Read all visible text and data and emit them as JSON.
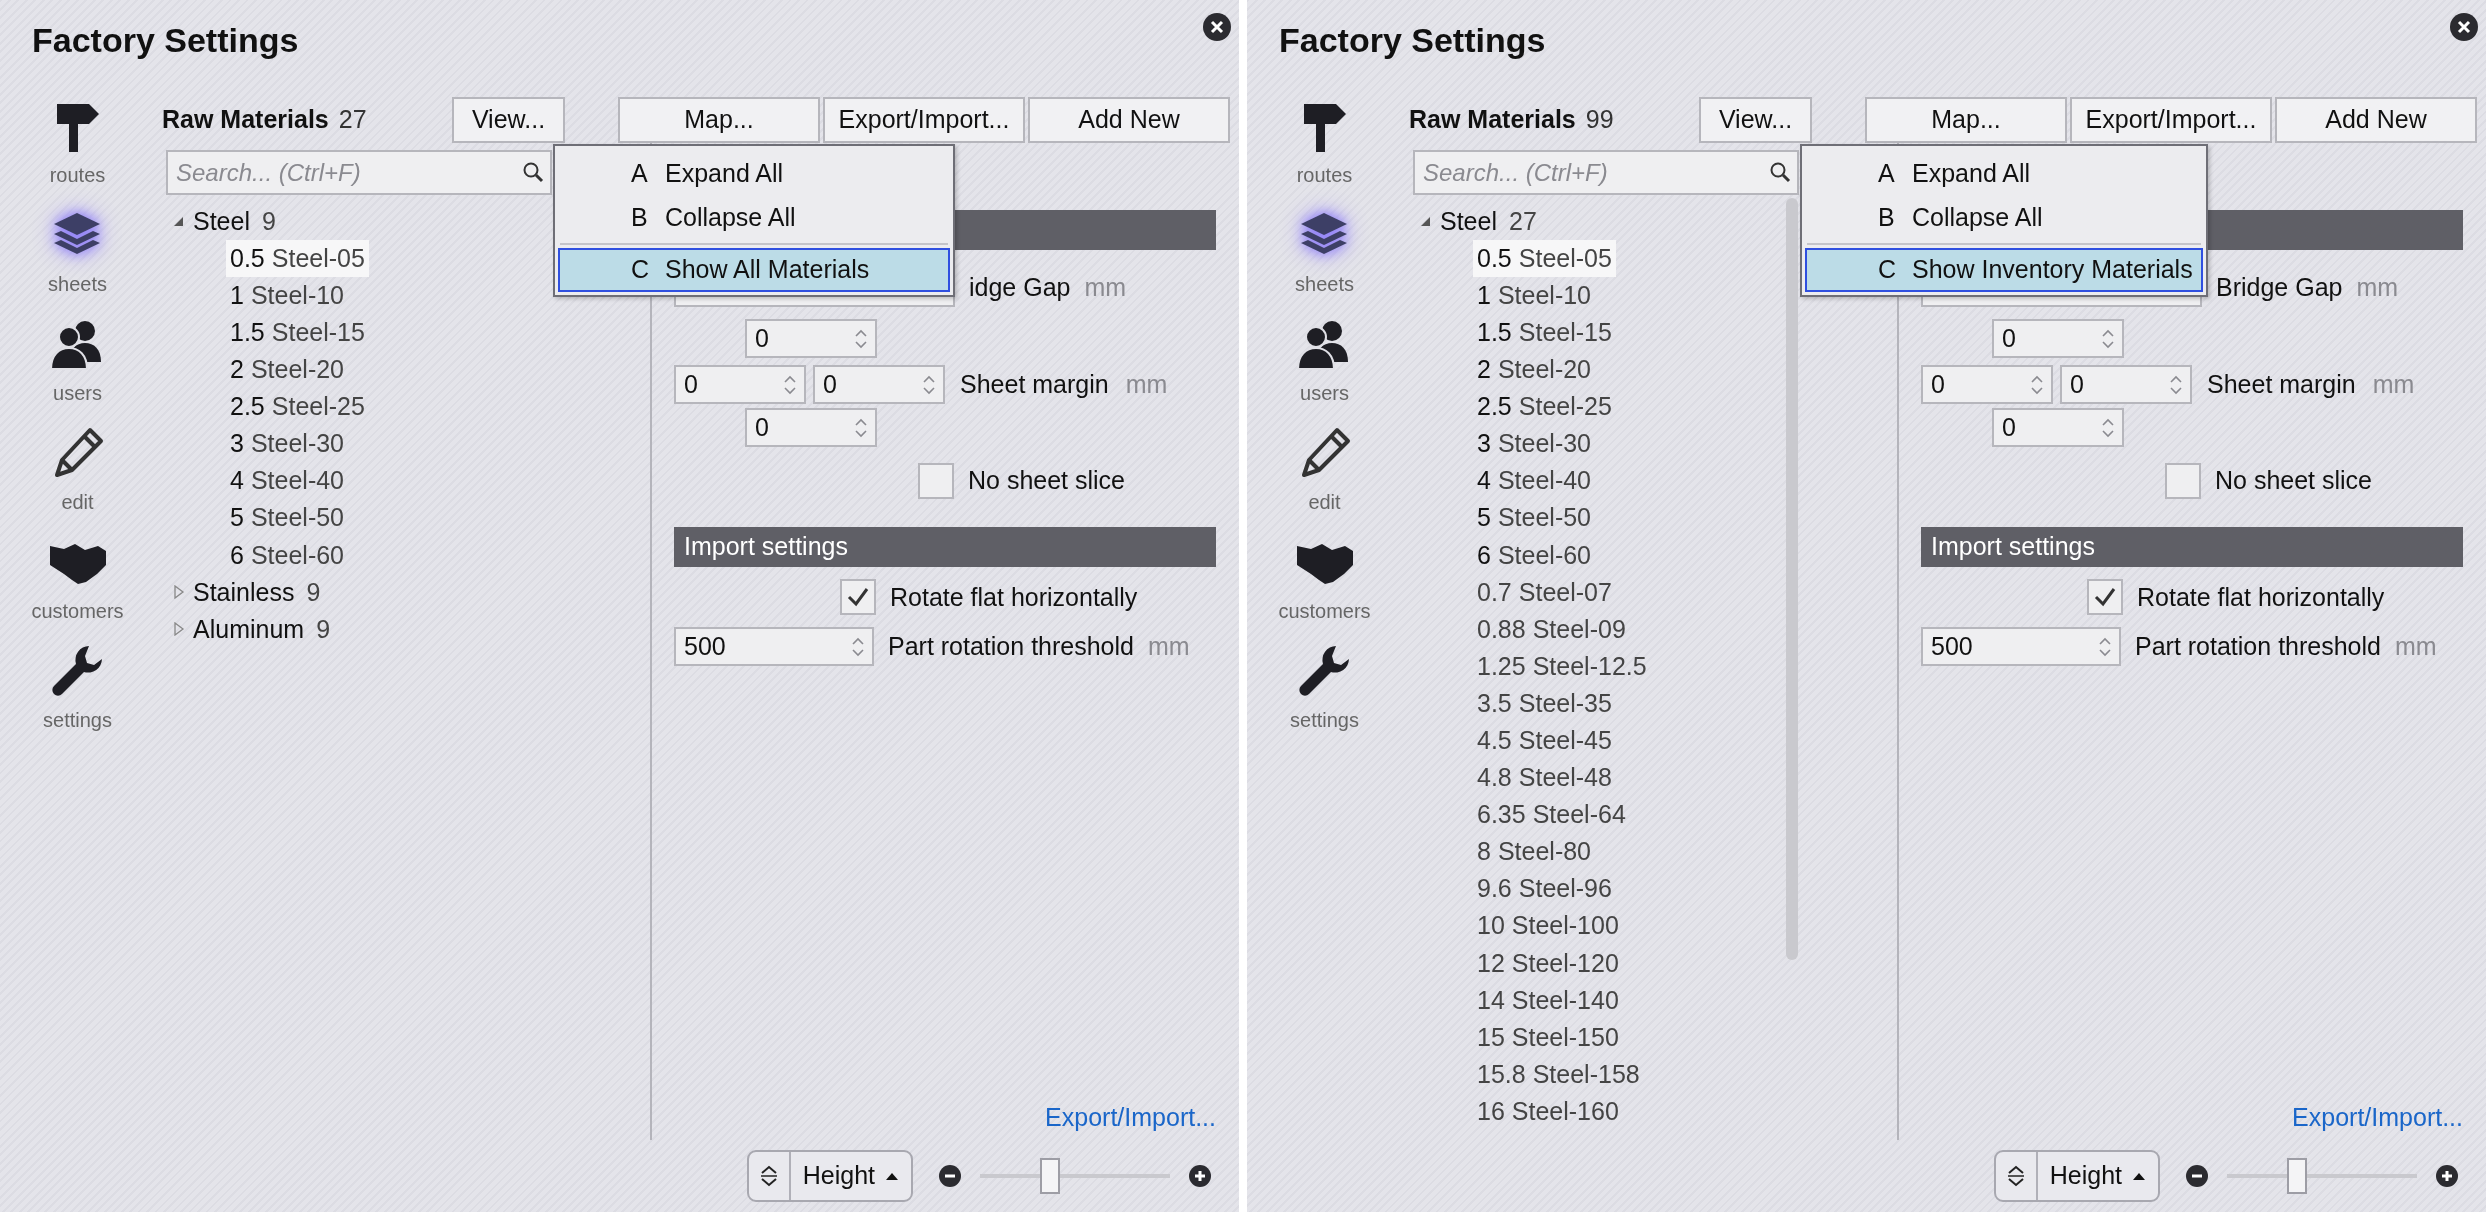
{
  "panels": [
    {
      "title": "Factory Settings",
      "nav": [
        {
          "label": "routes",
          "selected": false
        },
        {
          "label": "sheets",
          "selected": true
        },
        {
          "label": "users",
          "selected": false
        },
        {
          "label": "edit",
          "selected": false
        },
        {
          "label": "customers",
          "selected": false
        },
        {
          "label": "settings",
          "selected": false
        }
      ],
      "materials": {
        "heading": "Raw Materials",
        "count": "27",
        "view_button": "View...",
        "search": {
          "placeholder": "Search... (Ctrl+F)"
        },
        "scrollable": false,
        "tree": [
          {
            "label": "Steel",
            "count": "9",
            "expanded": true,
            "children": [
              {
                "thickness": "0.5",
                "name": "Steel-05",
                "selected": true,
                "inventory": true
              },
              {
                "thickness": "1",
                "name": "Steel-10",
                "selected": false,
                "inventory": true
              },
              {
                "thickness": "1.5",
                "name": "Steel-15",
                "selected": false,
                "inventory": true
              },
              {
                "thickness": "2",
                "name": "Steel-20",
                "selected": false,
                "inventory": true
              },
              {
                "thickness": "2.5",
                "name": "Steel-25",
                "selected": false,
                "inventory": true
              },
              {
                "thickness": "3",
                "name": "Steel-30",
                "selected": false,
                "inventory": true
              },
              {
                "thickness": "4",
                "name": "Steel-40",
                "selected": false,
                "inventory": true
              },
              {
                "thickness": "5",
                "name": "Steel-50",
                "selected": false,
                "inventory": true
              },
              {
                "thickness": "6",
                "name": "Steel-60",
                "selected": false,
                "inventory": true
              }
            ]
          },
          {
            "label": "Stainless",
            "count": "9",
            "expanded": false
          },
          {
            "label": "Aluminum",
            "count": "9",
            "expanded": false
          }
        ]
      },
      "toolbar": [
        {
          "label": "Map..."
        },
        {
          "label": "Export/Import..."
        },
        {
          "label": "Add New"
        }
      ],
      "view_menu": [
        {
          "key": "A",
          "label": "Expand All",
          "selected": false
        },
        {
          "key": "B",
          "label": "Collapse All",
          "selected": false
        },
        {
          "key": "C",
          "label": "Show All Materials",
          "selected": true
        }
      ],
      "settings": {
        "bridge_gap": {
          "label": "idge Gap",
          "unit": "mm"
        },
        "spinner_top": {
          "value": "0"
        },
        "sheet_margin": {
          "values": [
            "0",
            "0"
          ],
          "label": "Sheet margin",
          "unit": "mm"
        },
        "spinner_bottom": {
          "value": "0"
        },
        "no_sheet_slice": {
          "label": "No sheet slice",
          "checked": false
        },
        "import_header": "Import settings",
        "rotate_flat": {
          "label": "Rotate flat horizontally",
          "checked": true
        },
        "rotation_threshold": {
          "value": "500",
          "label": "Part rotation threshold",
          "unit": "mm"
        },
        "link": "Export/Import..."
      },
      "footer": {
        "sort_label": "Height",
        "zoom": {
          "level": 0.36
        }
      }
    },
    {
      "title": "Factory Settings",
      "nav": [
        {
          "label": "routes",
          "selected": false
        },
        {
          "label": "sheets",
          "selected": true
        },
        {
          "label": "users",
          "selected": false
        },
        {
          "label": "edit",
          "selected": false
        },
        {
          "label": "customers",
          "selected": false
        },
        {
          "label": "settings",
          "selected": false
        }
      ],
      "materials": {
        "heading": "Raw Materials",
        "count": "99",
        "view_button": "View...",
        "search": {
          "placeholder": "Search... (Ctrl+F)"
        },
        "scrollable": true,
        "tree": [
          {
            "label": "Steel",
            "count": "27",
            "expanded": true,
            "children": [
              {
                "thickness": "0.5",
                "name": "Steel-05",
                "selected": true,
                "inventory": true
              },
              {
                "thickness": "1",
                "name": "Steel-10",
                "selected": false,
                "inventory": true
              },
              {
                "thickness": "1.5",
                "name": "Steel-15",
                "selected": false,
                "inventory": true
              },
              {
                "thickness": "2",
                "name": "Steel-20",
                "selected": false,
                "inventory": true
              },
              {
                "thickness": "2.5",
                "name": "Steel-25",
                "selected": false,
                "inventory": true
              },
              {
                "thickness": "3",
                "name": "Steel-30",
                "selected": false,
                "inventory": true
              },
              {
                "thickness": "4",
                "name": "Steel-40",
                "selected": false,
                "inventory": true
              },
              {
                "thickness": "5",
                "name": "Steel-50",
                "selected": false,
                "inventory": true
              },
              {
                "thickness": "6",
                "name": "Steel-60",
                "selected": false,
                "inventory": true
              },
              {
                "thickness": "0.7",
                "name": "Steel-07",
                "selected": false,
                "inventory": false
              },
              {
                "thickness": "0.88",
                "name": "Steel-09",
                "selected": false,
                "inventory": false
              },
              {
                "thickness": "1.25",
                "name": "Steel-12.5",
                "selected": false,
                "inventory": false
              },
              {
                "thickness": "3.5",
                "name": "Steel-35",
                "selected": false,
                "inventory": false
              },
              {
                "thickness": "4.5",
                "name": "Steel-45",
                "selected": false,
                "inventory": false
              },
              {
                "thickness": "4.8",
                "name": "Steel-48",
                "selected": false,
                "inventory": false
              },
              {
                "thickness": "6.35",
                "name": "Steel-64",
                "selected": false,
                "inventory": false
              },
              {
                "thickness": "8",
                "name": "Steel-80",
                "selected": false,
                "inventory": false
              },
              {
                "thickness": "9.6",
                "name": "Steel-96",
                "selected": false,
                "inventory": false
              },
              {
                "thickness": "10",
                "name": "Steel-100",
                "selected": false,
                "inventory": false
              },
              {
                "thickness": "12",
                "name": "Steel-120",
                "selected": false,
                "inventory": false
              },
              {
                "thickness": "14",
                "name": "Steel-140",
                "selected": false,
                "inventory": false
              },
              {
                "thickness": "15",
                "name": "Steel-150",
                "selected": false,
                "inventory": false
              },
              {
                "thickness": "15.8",
                "name": "Steel-158",
                "selected": false,
                "inventory": false
              },
              {
                "thickness": "16",
                "name": "Steel-160",
                "selected": false,
                "inventory": false
              }
            ]
          }
        ]
      },
      "toolbar": [
        {
          "label": "Map..."
        },
        {
          "label": "Export/Import..."
        },
        {
          "label": "Add New"
        }
      ],
      "view_menu": [
        {
          "key": "A",
          "label": "Expand All",
          "selected": false
        },
        {
          "key": "B",
          "label": "Collapse All",
          "selected": false
        },
        {
          "key": "C",
          "label": "Show Inventory Materials",
          "selected": true
        }
      ],
      "settings": {
        "bridge_gap": {
          "label": "Bridge Gap",
          "unit": "mm"
        },
        "spinner_top": {
          "value": "0"
        },
        "sheet_margin": {
          "values": [
            "0",
            "0"
          ],
          "label": "Sheet margin",
          "unit": "mm"
        },
        "spinner_bottom": {
          "value": "0"
        },
        "no_sheet_slice": {
          "label": "No sheet slice",
          "checked": false
        },
        "import_header": "Import settings",
        "rotate_flat": {
          "label": "Rotate flat horizontally",
          "checked": true
        },
        "rotation_threshold": {
          "value": "500",
          "label": "Part rotation threshold",
          "unit": "mm"
        },
        "link": "Export/Import..."
      },
      "footer": {
        "sort_label": "Height",
        "zoom": {
          "level": 0.36
        }
      }
    }
  ]
}
